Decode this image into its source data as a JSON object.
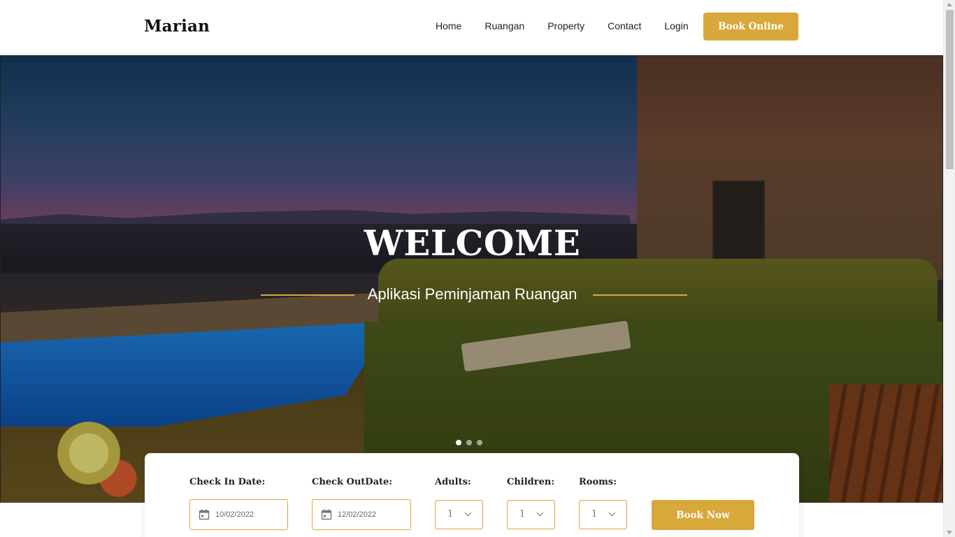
{
  "header": {
    "logo": "Marian",
    "nav": [
      "Home",
      "Ruangan",
      "Property",
      "Contact",
      "Login"
    ],
    "book_online": "Book Online"
  },
  "hero": {
    "title": "WELCOME",
    "subtitle": "Aplikasi Peminjaman Ruangan",
    "slides": 3,
    "active_slide": 1
  },
  "booking": {
    "check_in_label": "Check In Date:",
    "check_in_value": "10/02/2022",
    "check_out_label": "Check OutDate:",
    "check_out_value": "12/02/2022",
    "adults_label": "Adults:",
    "adults_value": "1",
    "children_label": "Children:",
    "children_value": "1",
    "rooms_label": "Rooms:",
    "rooms_value": "1",
    "submit": "Book Now"
  },
  "colors": {
    "accent": "#d8a83a",
    "text": "#222222",
    "white": "#ffffff"
  },
  "icons": [
    "calendar-icon",
    "chevron-down-icon"
  ]
}
